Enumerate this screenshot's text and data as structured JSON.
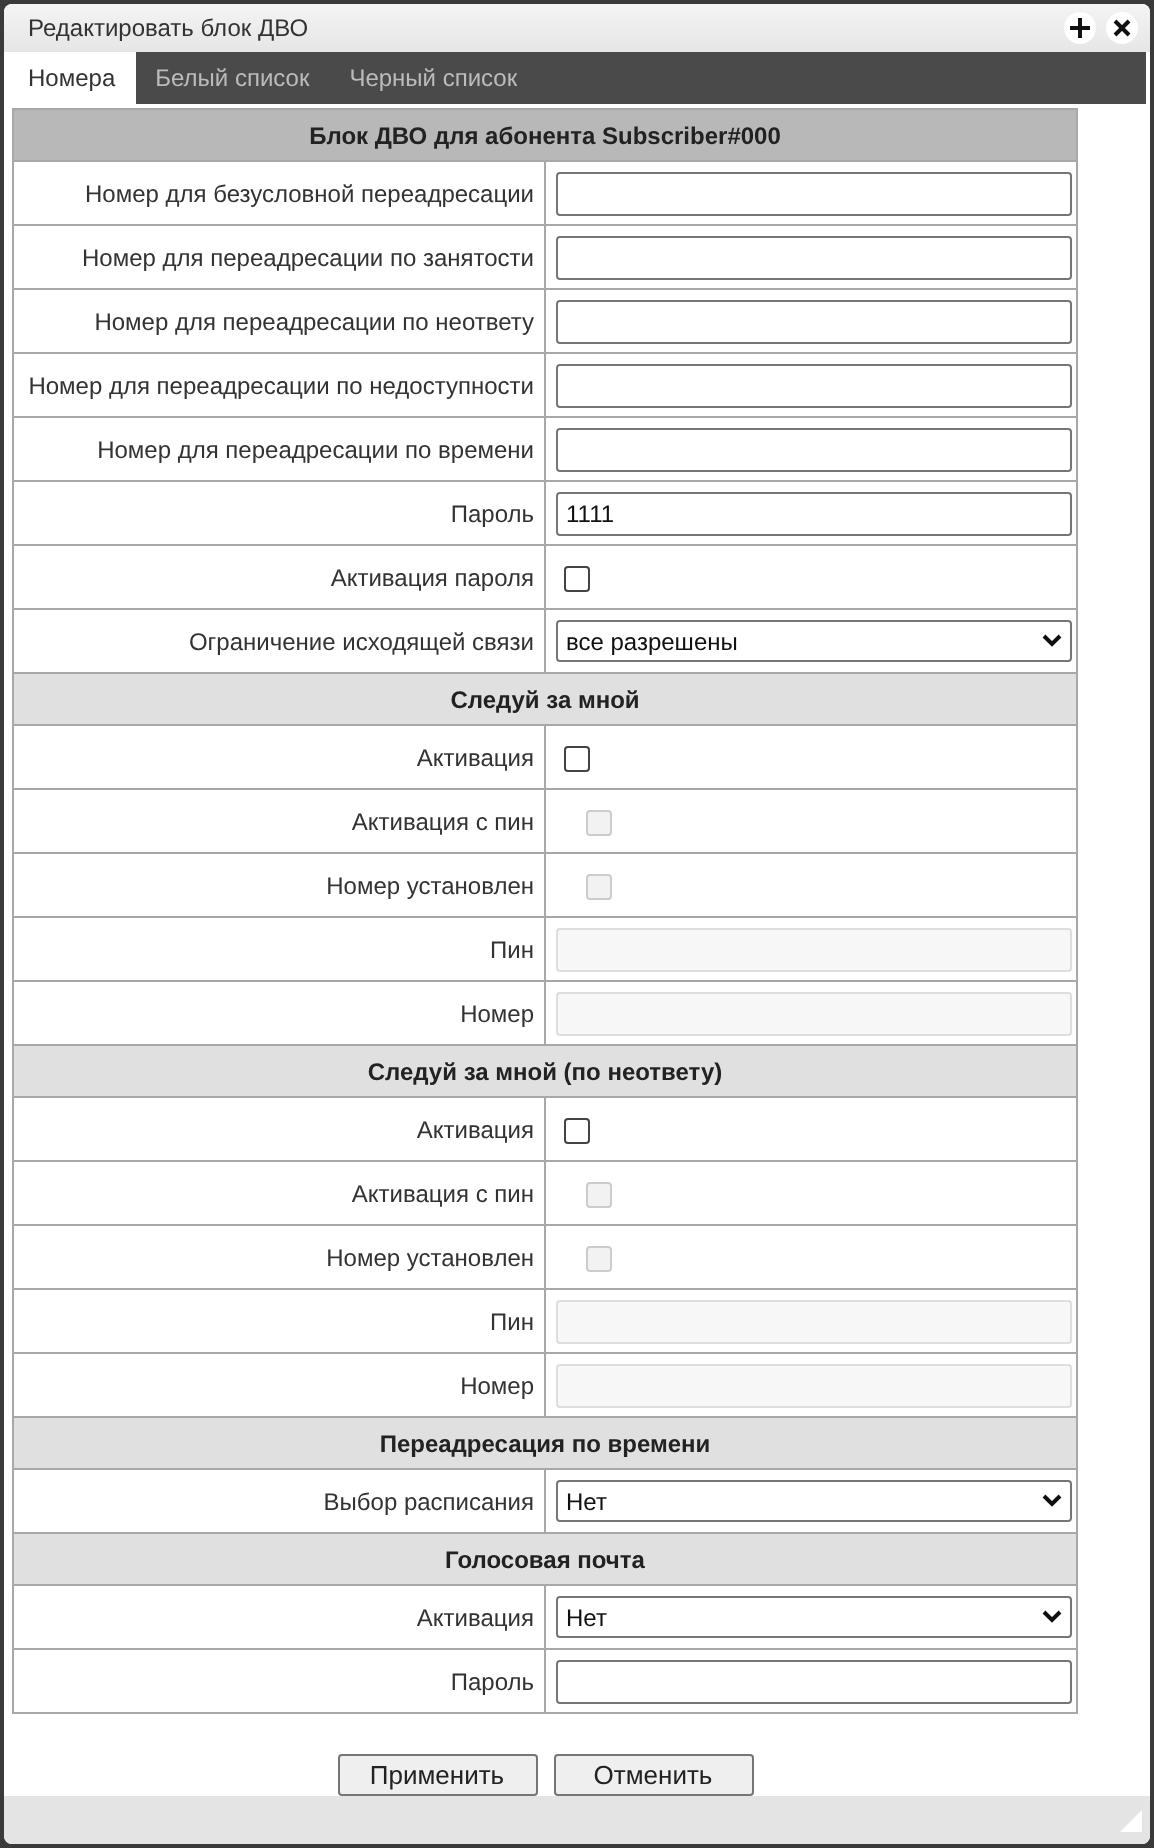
{
  "dialog": {
    "title": "Редактировать блок ДВО"
  },
  "tabs": [
    {
      "label": "Номера",
      "selected": true
    },
    {
      "label": "Белый список",
      "selected": false
    },
    {
      "label": "Черный список",
      "selected": false
    }
  ],
  "sections": [
    {
      "title": "Блок ДВО для абонента Subscriber#000",
      "kind": "main",
      "rows": [
        {
          "label": "Номер для безусловной переадресации",
          "kind": "text",
          "disabled": false
        },
        {
          "label": "Номер для переадресации по занятости",
          "kind": "text",
          "disabled": false
        },
        {
          "label": "Номер для переадресации по неответу",
          "kind": "text",
          "disabled": false
        },
        {
          "label": "Номер для переадресации по недоступности",
          "kind": "text",
          "disabled": false
        },
        {
          "label": "Номер для переадресации по времени",
          "kind": "text",
          "disabled": false
        },
        {
          "label": "Пароль",
          "kind": "text",
          "value": "1111",
          "disabled": false
        },
        {
          "label": "Активация пароля",
          "kind": "checkbox",
          "checked": false,
          "disabled": false
        },
        {
          "label": "Ограничение исходящей связи",
          "kind": "select",
          "value": "все разрешены"
        }
      ]
    },
    {
      "title": "Следуй за мной",
      "kind": "sub",
      "rows": [
        {
          "label": "Активация",
          "kind": "checkbox",
          "checked": false,
          "disabled": false
        },
        {
          "label": "Активация с пин",
          "kind": "checkbox",
          "checked": false,
          "disabled": true
        },
        {
          "label": "Номер установлен",
          "kind": "checkbox",
          "checked": false,
          "disabled": true
        },
        {
          "label": "Пин",
          "kind": "text",
          "disabled": true
        },
        {
          "label": "Номер",
          "kind": "text",
          "disabled": true
        }
      ]
    },
    {
      "title": "Следуй за мной (по неответу)",
      "kind": "sub",
      "rows": [
        {
          "label": "Активация",
          "kind": "checkbox",
          "checked": false,
          "disabled": false
        },
        {
          "label": "Активация с пин",
          "kind": "checkbox",
          "checked": false,
          "disabled": true
        },
        {
          "label": "Номер установлен",
          "kind": "checkbox",
          "checked": false,
          "disabled": true
        },
        {
          "label": "Пин",
          "kind": "text",
          "disabled": true
        },
        {
          "label": "Номер",
          "kind": "text",
          "disabled": true
        }
      ]
    },
    {
      "title": "Переадресация по времени",
      "kind": "sub",
      "rows": [
        {
          "label": "Выбор расписания",
          "kind": "select",
          "value": "Нет"
        }
      ]
    },
    {
      "title": "Голосовая почта",
      "kind": "sub",
      "rows": [
        {
          "label": "Активация",
          "kind": "select",
          "value": "Нет"
        },
        {
          "label": "Пароль",
          "kind": "text",
          "disabled": false
        }
      ]
    }
  ],
  "buttons": [
    "Применить",
    "Отменить"
  ]
}
